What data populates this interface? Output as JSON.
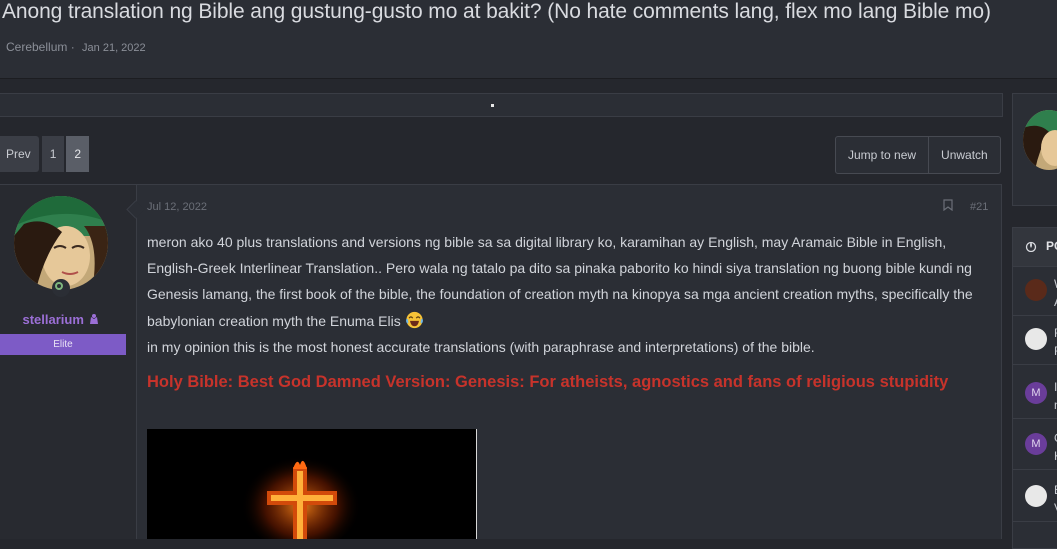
{
  "thread": {
    "title": "Anong translation ng Bible ang gustung-gusto mo at bakit? (No hate comments lang, flex mo lang Bible mo)",
    "author": "Cerebellum",
    "separator": "·",
    "date": "Jan 21, 2022"
  },
  "pagination": {
    "prev_label": "Prev",
    "pages": [
      "1",
      "2"
    ],
    "current": "2"
  },
  "actions": {
    "jump_label": "Jump to new",
    "unwatch_label": "Unwatch"
  },
  "post": {
    "username": "stellarium",
    "user_banner": "Elite",
    "date": "Jul 12, 2022",
    "number": "#21",
    "paragraph1": "meron ako 40 plus translations and versions ng bible sa sa digital library ko, karamihan ay English, may Aramaic Bible in English, English-Greek Interlinear Translation.. Pero wala ng tatalo pa dito sa pinaka paborito ko hindi siya translation ng buong bible kundi ng Genesis lamang, the first book of the bible, the foundation of creation myth na kinopya sa mga ancient creation myths, specifically the babylonian creation myth the Enuma Elis",
    "paragraph2": "in my opinion this is the most honest accurate translations (with paraphrase and interpretations) of the bible.",
    "book_link": "Holy Bible: Best God Damned Version: Genesis: For atheists, agnostics and fans of religious stupidity"
  },
  "sidebar": {
    "panel_label": "PC",
    "items": [
      {
        "l1": "W",
        "l2": "A",
        "av": ""
      },
      {
        "l1": "F",
        "l2": "F",
        "av": ""
      },
      {
        "l1": "I",
        "l2": "n",
        "av": "M"
      },
      {
        "l1": "G",
        "l2": "K",
        "av": "M"
      },
      {
        "l1": "B",
        "l2": "V",
        "av": ""
      }
    ]
  },
  "colors": {
    "background": "#25272d",
    "panel": "#2b2e35",
    "username": "#9b6fd6",
    "banner": "#7d5bc6",
    "link_red": "#c7332b",
    "avatar_m": "#6a3d9a"
  },
  "icons": [
    "bookmark-icon",
    "laughing-emoji-icon",
    "online-status-icon",
    "fire-icon"
  ]
}
